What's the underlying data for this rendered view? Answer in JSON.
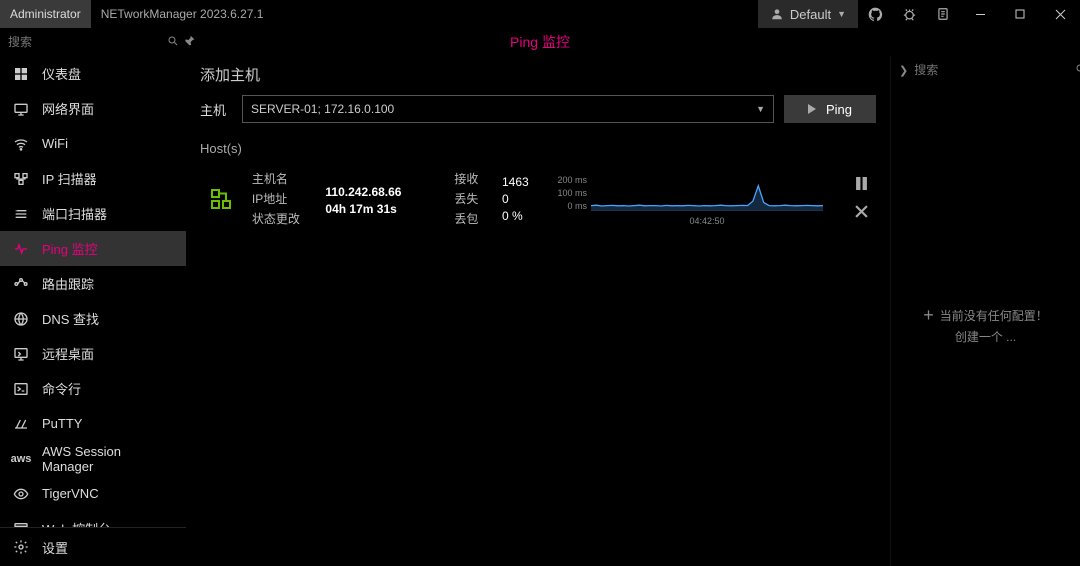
{
  "titlebar": {
    "admin": "Administrator",
    "app": "NETworkManager 2023.6.27.1",
    "profile": "Default"
  },
  "search": {
    "placeholder": "搜索"
  },
  "page_title": "Ping 监控",
  "nav": [
    {
      "icon": "dashboard-icon",
      "label": "仪表盘"
    },
    {
      "icon": "network-icon",
      "label": "网络界面"
    },
    {
      "icon": "wifi-icon",
      "label": "WiFi"
    },
    {
      "icon": "ipscanner-icon",
      "label": "IP 扫描器"
    },
    {
      "icon": "portscanner-icon",
      "label": "端口扫描器"
    },
    {
      "icon": "pingmonitor-icon",
      "label": "Ping 监控"
    },
    {
      "icon": "traceroute-icon",
      "label": "路由跟踪"
    },
    {
      "icon": "dns-icon",
      "label": "DNS 查找"
    },
    {
      "icon": "rdp-icon",
      "label": "远程桌面"
    },
    {
      "icon": "powershell-icon",
      "label": "命令行"
    },
    {
      "icon": "putty-icon",
      "label": "PuTTY"
    },
    {
      "icon": "aws-icon",
      "label": "AWS Session Manager"
    },
    {
      "icon": "tigervnc-icon",
      "label": "TigerVNC"
    },
    {
      "icon": "webconsole-icon",
      "label": "Web 控制台"
    }
  ],
  "settings": "设置",
  "main": {
    "add_host_title": "添加主机",
    "host_label": "主机",
    "host_value": "SERVER-01; 172.16.0.100",
    "ping_btn": "Ping",
    "hosts_label": "Host(s)"
  },
  "host": {
    "labels": {
      "name": "主机名",
      "ip": "IP地址",
      "status": "状态更改"
    },
    "values": {
      "name": "",
      "ip": "110.242.68.66",
      "status": "04h 17m 31s"
    },
    "stats_labels": {
      "recv": "接收",
      "lost": "丢失",
      "loss": "丢包"
    },
    "stats_values": {
      "recv": "1463",
      "lost": "0",
      "loss": "0 %"
    }
  },
  "chart_data": {
    "type": "line",
    "ylim": [
      0,
      200
    ],
    "yticks": [
      "200 ms",
      "100 ms",
      "0 ms"
    ],
    "xlabel": "04:42:50",
    "values": [
      30,
      32,
      28,
      30,
      31,
      29,
      30,
      28,
      30,
      32,
      29,
      30,
      30,
      28,
      31,
      29,
      30,
      29,
      31,
      30,
      28,
      30,
      29,
      30,
      32,
      30,
      29,
      30,
      31,
      30,
      55,
      140,
      48,
      30,
      29,
      30,
      32,
      30,
      29,
      30,
      31,
      30,
      29,
      30
    ]
  },
  "right_pane": {
    "search_placeholder": "搜索",
    "empty_line1": "当前没有任何配置！",
    "empty_line2": "创建一个 ..."
  }
}
